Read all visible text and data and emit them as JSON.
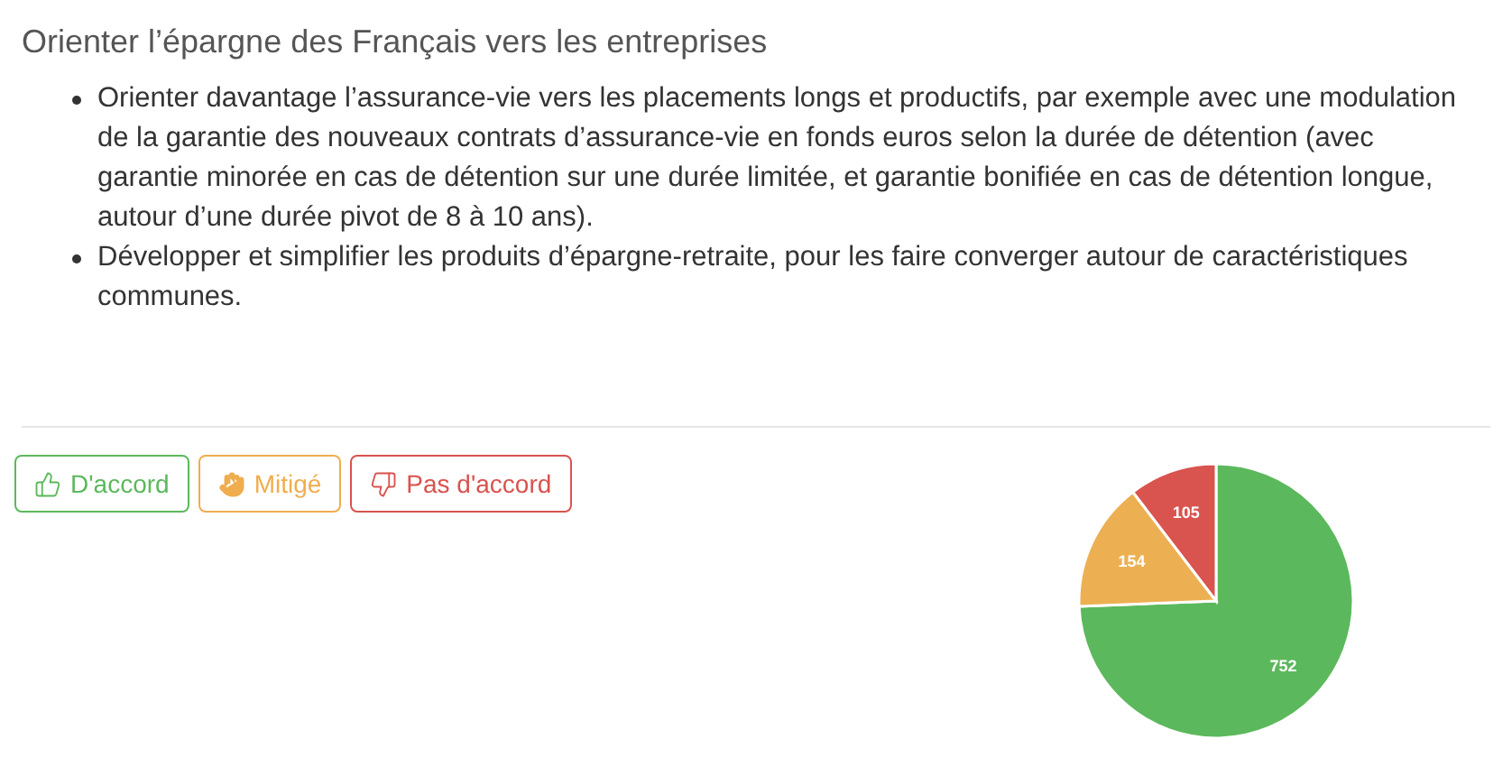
{
  "title": "Orienter l’épargne des Français vers les entreprises",
  "items": [
    "Orienter davantage l’assurance-vie vers les placements longs et productifs, par exemple avec une modulation de la garantie des nouveaux contrats d’assurance-vie en fonds euros selon la durée de détention (avec garantie minorée en cas de détention sur une durée limitée, et garantie bonifiée en cas de détention longue, autour d’une durée pivot de 8 à 10 ans).",
    "Développer et simplifier les produits d’épargne-retraite, pour les faire converger autour de caractéristiques communes."
  ],
  "votes": [
    {
      "kind": "agree",
      "label": "D'accord",
      "color": "#5cb85c"
    },
    {
      "kind": "mixed",
      "label": "Mitigé",
      "color": "#f0ad4e"
    },
    {
      "kind": "disagree",
      "label": "Pas d'accord",
      "color": "#d9534f"
    }
  ],
  "chart_data": {
    "type": "pie",
    "values": [
      752,
      154,
      105
    ],
    "data_labels": true
  }
}
